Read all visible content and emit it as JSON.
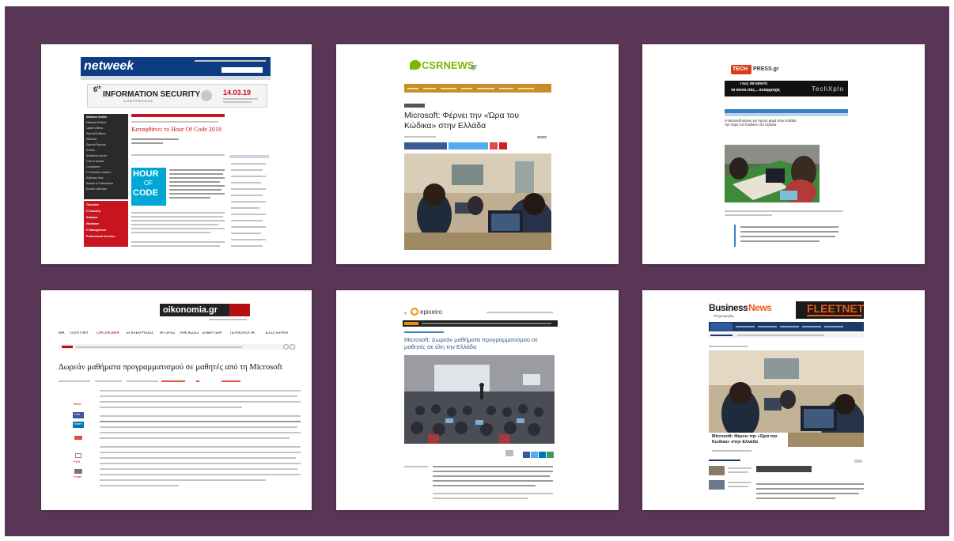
{
  "colors": {
    "background": "#5a3656",
    "netweek_blue": "#0d3c82",
    "netweek_red": "#c8141e",
    "csr_orange": "#c98c28",
    "csr_green": "#7ab800",
    "techpress_red": "#d83b1a",
    "oikonomia_red": "#b40f12",
    "epixeiro_orange": "#f08c00",
    "businessnews_orange": "#f05a14",
    "hoc_cyan": "#00a6d6"
  },
  "cards": {
    "netweek": {
      "logo": "netweek",
      "banner_title": "INFORMATION SECURITY",
      "banner_sub": "CONFERENCE",
      "banner_date": "14.03.19",
      "headline": "Καταφθάνει το Hour Of Code 2018",
      "hoc_logo": [
        "HOUR",
        "OF",
        "CODE"
      ],
      "sidebar_menu": [
        "Netweek Online",
        "Netweek Editors",
        "Latest Videos",
        "Special Editions",
        "Editorial",
        "Special Reports",
        "Events",
        "Academic Issues",
        "Cost of Assets",
        "Companies",
        "IT Decision Leaders",
        "Software Intro",
        "Search & Publications",
        "Events Calendar"
      ],
      "sidebar_red": [
        "Telecoms",
        "IT Industry",
        "Software",
        "Hardware",
        "IT Management",
        "Professional Services"
      ]
    },
    "csrnews": {
      "logo": "CSRNEWS",
      "logo_suffix": ".gr",
      "title": "Microsoft: Φέρνει την «Ώρα του Κώδικα» στην Ελλάδα"
    },
    "techpress": {
      "logo_badge": "TECH",
      "logo_rest": "PRESS.gr",
      "ad_text_1": "Πώς θα κάνετε",
      "ad_text_2": "τα κοινά σας... αδιάβροχα;",
      "ad_brand": "TechXplo",
      "headline": "Η Microsoft φέρνει για πρώτη φορά στην Ελλάδα την «Ώρα του Κώδικα» στα σχολεία"
    },
    "oikonomia": {
      "logo": "oikonomia.gr",
      "nav": [
        "ΜΑ",
        "ΠΟΛΙΤΙΚΗ",
        "ΟΙΚΟΝΟΜΙΑ",
        "ΕΠΙΧΕΙΡΗΣΕΙΣ",
        "ΑΓΟΡΕΣ",
        "ΤΡΑΠΕΖΕΣ",
        "ΕΝΕΡΓΕΙΑ",
        "ΤΕΧΝΟΛΟΓΙΑ",
        "ΕΣΩΤΕΡΙΚΑ"
      ],
      "headline": "Δωρεάν μαθήματα προγραμματισμού σε μαθητές από τη Microsoft",
      "share_labels": [
        "Tweet",
        "Like",
        "Share",
        "Print",
        "Email"
      ]
    },
    "epixeiro": {
      "logo": "epixeiro",
      "headline": "Microsoft: Δωρεάν μαθήματα προγραμματισμού σε μαθητές σε όλη την Ελλάδα"
    },
    "businessnews": {
      "logo_business": "Business",
      "logo_news": "News",
      "logo_sub": "Πληροφορίες",
      "ad_text": "FLEETNET",
      "title": "Microsoft: Φέρνει την «Ώρα του Κώδικα» στην Ελλάδα"
    }
  }
}
